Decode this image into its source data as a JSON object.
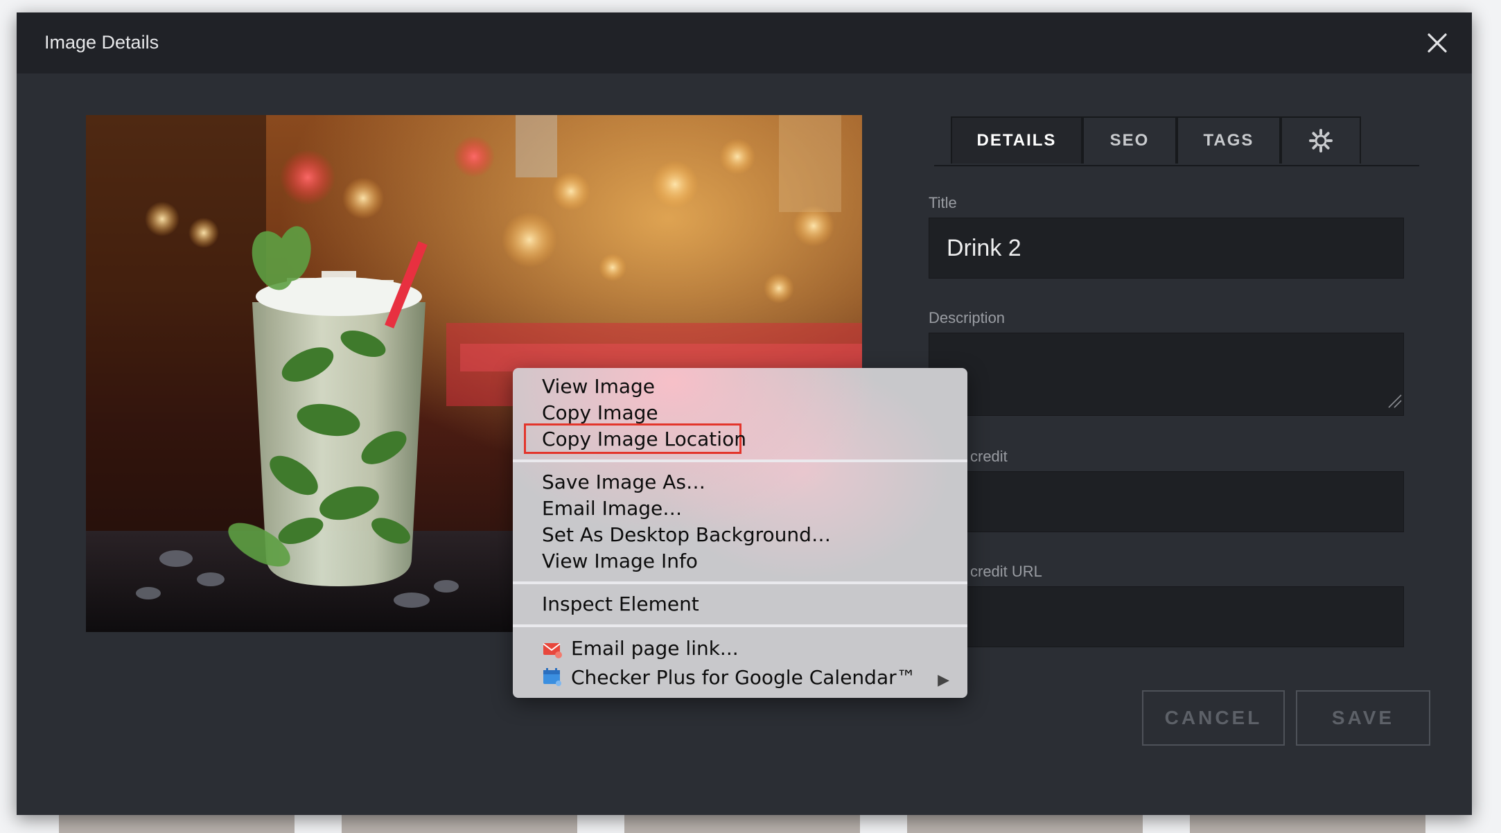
{
  "modal": {
    "title": "Image Details"
  },
  "tabs": [
    {
      "label": "DETAILS",
      "active": true
    },
    {
      "label": "SEO",
      "active": false
    },
    {
      "label": "TAGS",
      "active": false
    },
    {
      "icon": "gear-icon",
      "active": false
    }
  ],
  "form": {
    "title_label": "Title",
    "title_value": "Drink 2",
    "description_label": "Description",
    "description_value": "",
    "photo_credit_label": "credit",
    "photo_credit_value": "",
    "photo_credit_url_label": "credit URL",
    "photo_credit_url_value": ""
  },
  "buttons": {
    "cancel": "CANCEL",
    "save": "SAVE"
  },
  "context_menu": {
    "items": [
      "View Image",
      "Copy Image",
      "Copy Image Location",
      "Save Image As…",
      "Email Image…",
      "Set As Desktop Background…",
      "View Image Info",
      "Inspect Element",
      "Email page link...",
      "Checker Plus for Google Calendar™"
    ],
    "highlighted": "Copy Image Location",
    "highlight_color": "#e3352b"
  },
  "colors": {
    "modal_bg": "#2b2e34",
    "header_bg": "#202227",
    "field_bg": "#1e2024"
  }
}
